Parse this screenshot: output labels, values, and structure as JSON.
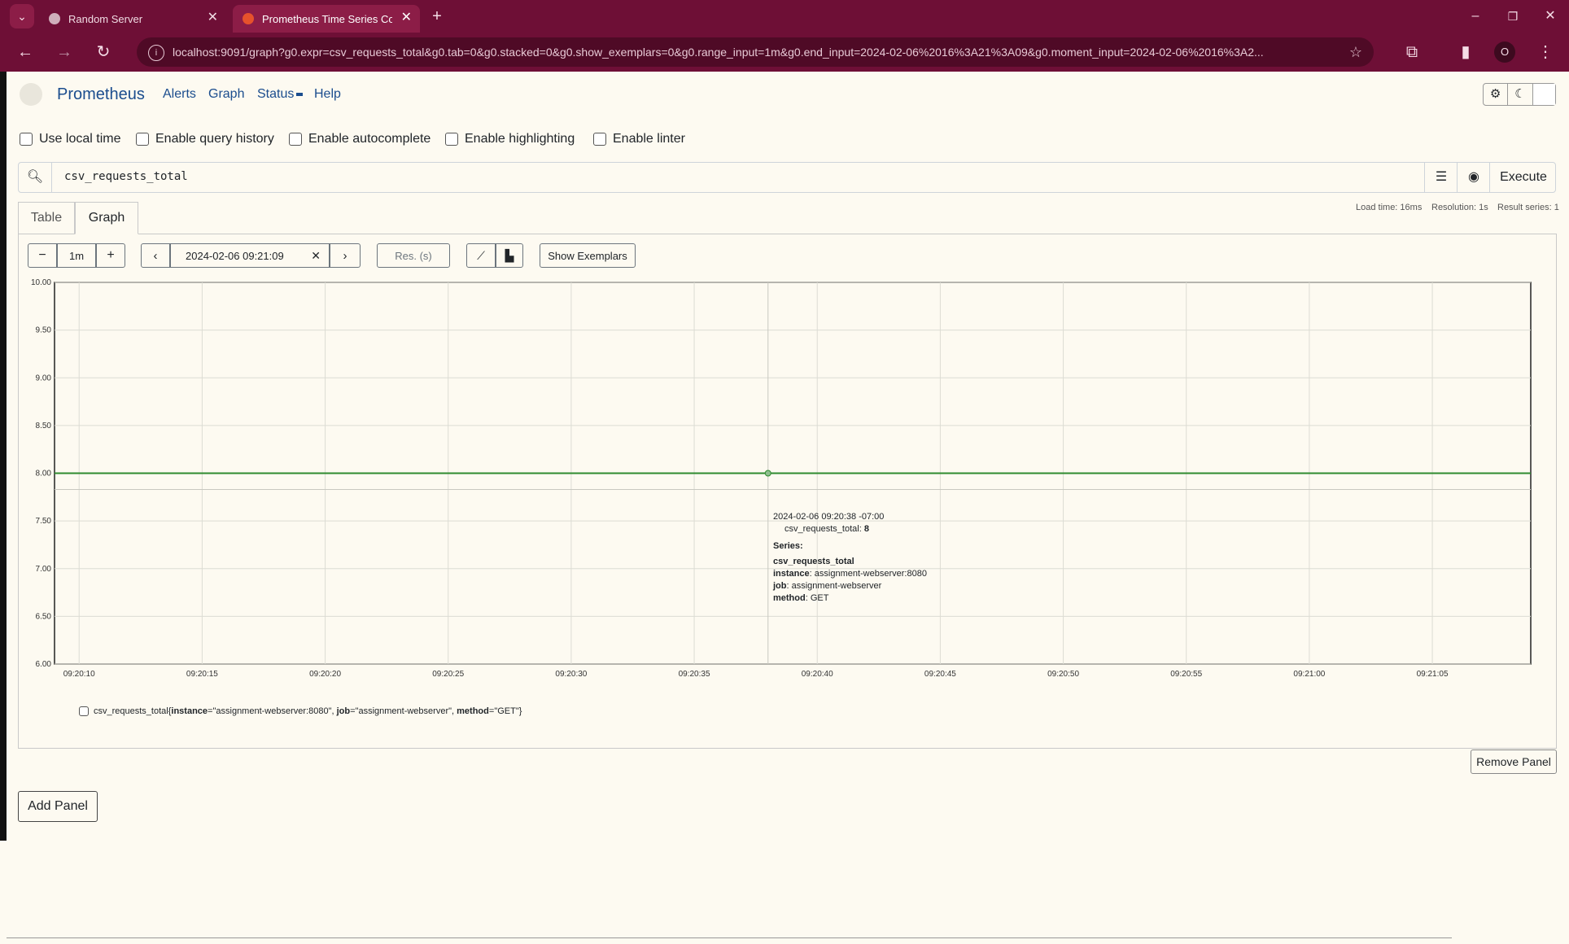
{
  "browser": {
    "tabs": [
      {
        "title": "Random Server"
      },
      {
        "title": "Prometheus Time Series Coll"
      }
    ],
    "url": "localhost:9091/graph?g0.expr=csv_requests_total&g0.tab=0&g0.stacked=0&g0.show_exemplars=0&g0.range_input=1m&g0.end_input=2024-02-06%2016%3A21%3A09&g0.moment_input=2024-02-06%2016%3A2...",
    "profile_letter": "O"
  },
  "nav": {
    "brand": "Prometheus",
    "links": [
      "Alerts",
      "Graph",
      "Status",
      "Help"
    ]
  },
  "options": [
    "Use local time",
    "Enable query history",
    "Enable autocomplete",
    "Enable highlighting",
    "Enable linter"
  ],
  "query": {
    "expr": "csv_requests_total",
    "execute_label": "Execute"
  },
  "tabs": {
    "table": "Table",
    "graph": "Graph"
  },
  "stats": {
    "load_time": "Load time: 16ms",
    "resolution": "Resolution: 1s",
    "result_series": "Result series: 1"
  },
  "controls": {
    "range": "1m",
    "end_time": "2024-02-06 09:21:09",
    "res_placeholder": "Res. (s)",
    "exemplars_label": "Show Exemplars"
  },
  "chart_data": {
    "type": "line",
    "x_ticks": [
      "09:20:10",
      "09:20:15",
      "09:20:20",
      "09:20:25",
      "09:20:30",
      "09:20:35",
      "09:20:40",
      "09:20:45",
      "09:20:50",
      "09:20:55",
      "09:21:00",
      "09:21:05"
    ],
    "y_ticks": [
      "10.00",
      "9.50",
      "9.00",
      "8.50",
      "8.00",
      "7.50",
      "7.00",
      "6.50",
      "6.00"
    ],
    "ylim": [
      6,
      10
    ],
    "xlim": [
      "09:20:09",
      "09:21:09"
    ],
    "series": [
      {
        "name": "csv_requests_total",
        "x": [
          "09:20:09",
          "09:21:09"
        ],
        "values": [
          8,
          8
        ],
        "color": "#2e8b2e"
      }
    ],
    "hover": {
      "x": "09:20:38",
      "y": 8
    },
    "grid": true
  },
  "tooltip": {
    "time": "2024-02-06 09:20:38 -07:00",
    "metric_key": "csv_requests_total",
    "metric_value": "8",
    "series_header": "Series:",
    "series_name": "csv_requests_total",
    "labels": [
      {
        "key": "instance",
        "value": "assignment-webserver:8080"
      },
      {
        "key": "job",
        "value": "assignment-webserver"
      },
      {
        "key": "method",
        "value": "GET"
      }
    ]
  },
  "legend": {
    "metric": "csv_requests_total",
    "labels": [
      {
        "key": "instance",
        "value": "\"assignment-webserver:8080\""
      },
      {
        "key": "job",
        "value": "\"assignment-webserver\""
      },
      {
        "key": "method",
        "value": "\"GET\""
      }
    ]
  },
  "buttons": {
    "remove_panel": "Remove Panel",
    "add_panel": "Add Panel"
  }
}
